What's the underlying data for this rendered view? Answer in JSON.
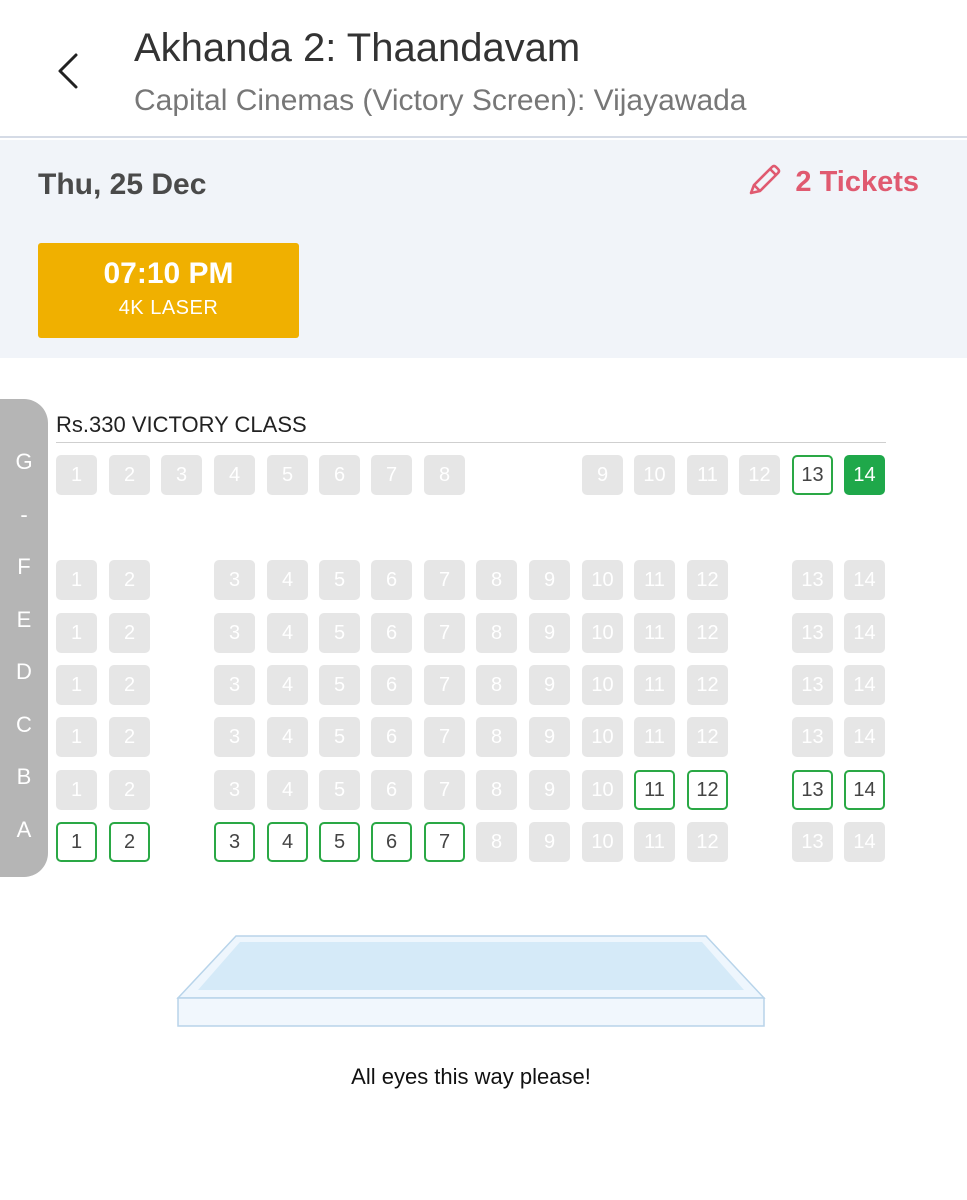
{
  "header": {
    "title": "Akhanda 2: Thaandavam",
    "subtitle": "Capital Cinemas (Victory Screen): Vijayawada"
  },
  "show": {
    "date": "Thu, 25 Dec",
    "tickets_label": "2 Tickets",
    "time": "07:10 PM",
    "format": "4K LASER"
  },
  "seat_class": "Rs.330  VICTORY CLASS",
  "row_labels": [
    "G",
    "-",
    "F",
    "E",
    "D",
    "C",
    "B",
    "A"
  ],
  "seat_rows": [
    {
      "row": "G",
      "seats": [
        {
          "n": "1",
          "s": "sold"
        },
        {
          "n": "2",
          "s": "sold"
        },
        {
          "n": "3",
          "s": "sold"
        },
        {
          "n": "4",
          "s": "sold"
        },
        {
          "n": "5",
          "s": "sold"
        },
        {
          "n": "6",
          "s": "sold"
        },
        {
          "n": "7",
          "s": "sold"
        },
        {
          "n": "8",
          "s": "sold"
        },
        {
          "n": "9",
          "s": "sold"
        },
        {
          "n": "10",
          "s": "sold"
        },
        {
          "n": "11",
          "s": "sold"
        },
        {
          "n": "12",
          "s": "sold"
        },
        {
          "n": "13",
          "s": "available"
        },
        {
          "n": "14",
          "s": "selected"
        }
      ]
    },
    {
      "row": "F",
      "seats": [
        {
          "n": "1",
          "s": "sold"
        },
        {
          "n": "2",
          "s": "sold"
        },
        {
          "n": "3",
          "s": "sold"
        },
        {
          "n": "4",
          "s": "sold"
        },
        {
          "n": "5",
          "s": "sold"
        },
        {
          "n": "6",
          "s": "sold"
        },
        {
          "n": "7",
          "s": "sold"
        },
        {
          "n": "8",
          "s": "sold"
        },
        {
          "n": "9",
          "s": "sold"
        },
        {
          "n": "10",
          "s": "sold"
        },
        {
          "n": "11",
          "s": "sold"
        },
        {
          "n": "12",
          "s": "sold"
        },
        {
          "n": "13",
          "s": "sold"
        },
        {
          "n": "14",
          "s": "sold"
        }
      ]
    },
    {
      "row": "E",
      "seats": [
        {
          "n": "1",
          "s": "sold"
        },
        {
          "n": "2",
          "s": "sold"
        },
        {
          "n": "3",
          "s": "sold"
        },
        {
          "n": "4",
          "s": "sold"
        },
        {
          "n": "5",
          "s": "sold"
        },
        {
          "n": "6",
          "s": "sold"
        },
        {
          "n": "7",
          "s": "sold"
        },
        {
          "n": "8",
          "s": "sold"
        },
        {
          "n": "9",
          "s": "sold"
        },
        {
          "n": "10",
          "s": "sold"
        },
        {
          "n": "11",
          "s": "sold"
        },
        {
          "n": "12",
          "s": "sold"
        },
        {
          "n": "13",
          "s": "sold"
        },
        {
          "n": "14",
          "s": "sold"
        }
      ]
    },
    {
      "row": "D",
      "seats": [
        {
          "n": "1",
          "s": "sold"
        },
        {
          "n": "2",
          "s": "sold"
        },
        {
          "n": "3",
          "s": "sold"
        },
        {
          "n": "4",
          "s": "sold"
        },
        {
          "n": "5",
          "s": "sold"
        },
        {
          "n": "6",
          "s": "sold"
        },
        {
          "n": "7",
          "s": "sold"
        },
        {
          "n": "8",
          "s": "sold"
        },
        {
          "n": "9",
          "s": "sold"
        },
        {
          "n": "10",
          "s": "sold"
        },
        {
          "n": "11",
          "s": "sold"
        },
        {
          "n": "12",
          "s": "sold"
        },
        {
          "n": "13",
          "s": "sold"
        },
        {
          "n": "14",
          "s": "sold"
        }
      ]
    },
    {
      "row": "C",
      "seats": [
        {
          "n": "1",
          "s": "sold"
        },
        {
          "n": "2",
          "s": "sold"
        },
        {
          "n": "3",
          "s": "sold"
        },
        {
          "n": "4",
          "s": "sold"
        },
        {
          "n": "5",
          "s": "sold"
        },
        {
          "n": "6",
          "s": "sold"
        },
        {
          "n": "7",
          "s": "sold"
        },
        {
          "n": "8",
          "s": "sold"
        },
        {
          "n": "9",
          "s": "sold"
        },
        {
          "n": "10",
          "s": "sold"
        },
        {
          "n": "11",
          "s": "sold"
        },
        {
          "n": "12",
          "s": "sold"
        },
        {
          "n": "13",
          "s": "sold"
        },
        {
          "n": "14",
          "s": "sold"
        }
      ]
    },
    {
      "row": "B",
      "seats": [
        {
          "n": "1",
          "s": "sold"
        },
        {
          "n": "2",
          "s": "sold"
        },
        {
          "n": "3",
          "s": "sold"
        },
        {
          "n": "4",
          "s": "sold"
        },
        {
          "n": "5",
          "s": "sold"
        },
        {
          "n": "6",
          "s": "sold"
        },
        {
          "n": "7",
          "s": "sold"
        },
        {
          "n": "8",
          "s": "sold"
        },
        {
          "n": "9",
          "s": "sold"
        },
        {
          "n": "10",
          "s": "sold"
        },
        {
          "n": "11",
          "s": "available"
        },
        {
          "n": "12",
          "s": "available"
        },
        {
          "n": "13",
          "s": "available"
        },
        {
          "n": "14",
          "s": "available"
        }
      ]
    },
    {
      "row": "A",
      "seats": [
        {
          "n": "1",
          "s": "available"
        },
        {
          "n": "2",
          "s": "available"
        },
        {
          "n": "3",
          "s": "available"
        },
        {
          "n": "4",
          "s": "available"
        },
        {
          "n": "5",
          "s": "available"
        },
        {
          "n": "6",
          "s": "available"
        },
        {
          "n": "7",
          "s": "available"
        },
        {
          "n": "8",
          "s": "sold"
        },
        {
          "n": "9",
          "s": "sold"
        },
        {
          "n": "10",
          "s": "sold"
        },
        {
          "n": "11",
          "s": "sold"
        },
        {
          "n": "12",
          "s": "sold"
        },
        {
          "n": "13",
          "s": "sold"
        },
        {
          "n": "14",
          "s": "sold"
        }
      ]
    }
  ],
  "screen_caption": "All eyes this way please!",
  "colors": {
    "accent_pink": "#e05a70",
    "showtime_yellow": "#f0b000",
    "available_green": "#2aa845",
    "selected_green": "#1fa84a",
    "sold_grey": "#e6e6e6"
  }
}
